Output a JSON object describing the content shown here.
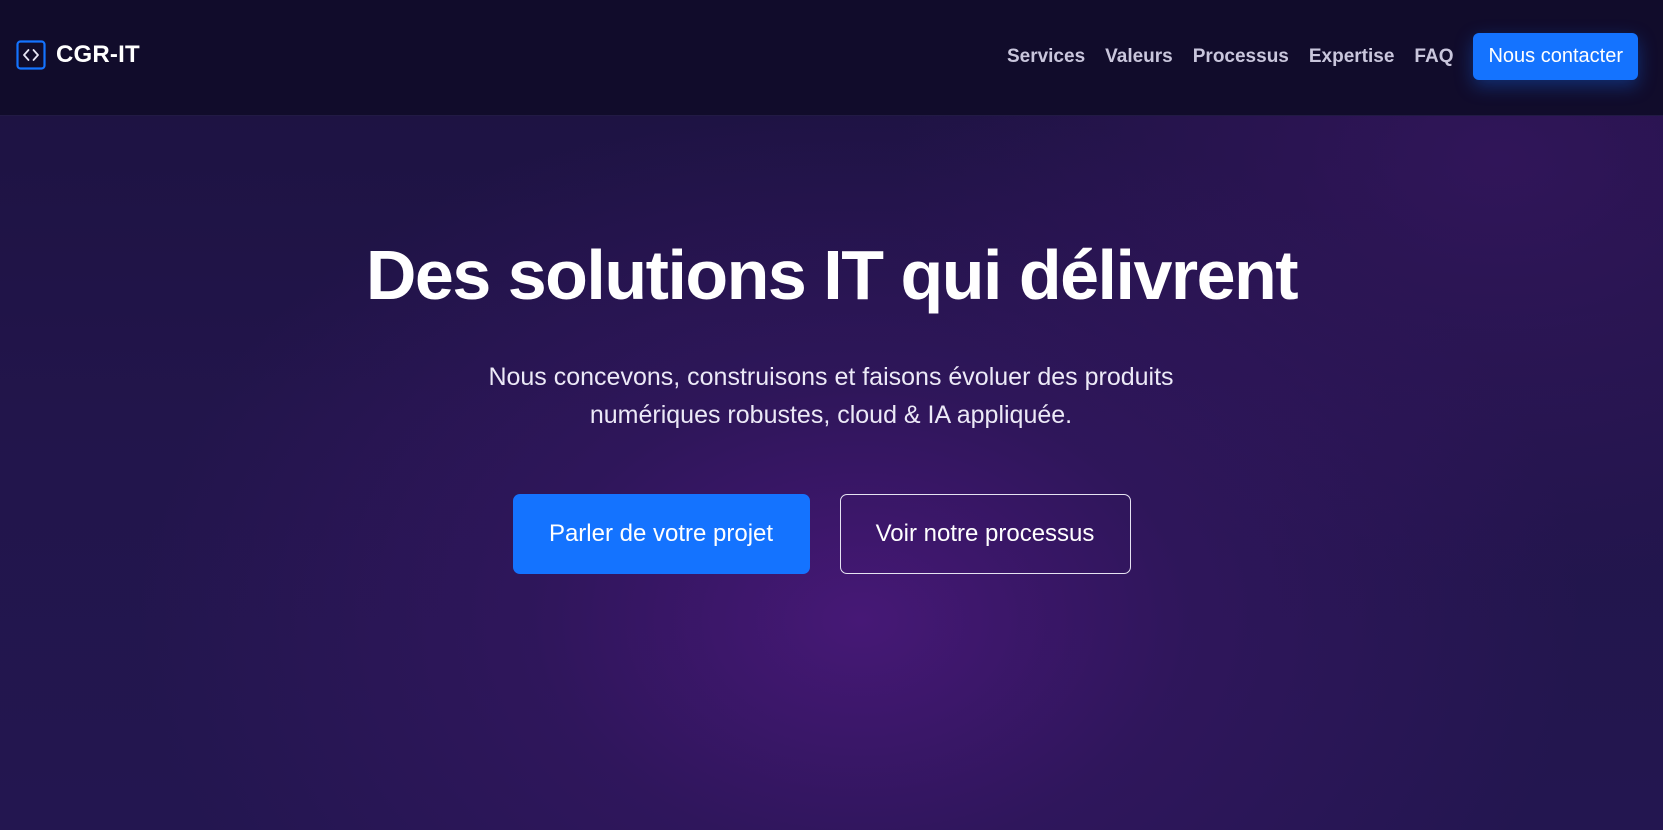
{
  "brand": {
    "name": "CGR-IT",
    "icon": "code-brackets-icon",
    "accent_color": "#1473ff"
  },
  "nav": {
    "links": [
      "Services",
      "Valeurs",
      "Processus",
      "Expertise",
      "FAQ"
    ],
    "cta_label": "Nous contacter"
  },
  "hero": {
    "title": "Des solutions IT qui délivrent",
    "subtitle": "Nous concevons, construisons et faisons évoluer des produits numériques robustes, cloud & IA appliquée.",
    "primary_button": "Parler de votre projet",
    "secondary_button": "Voir notre processus"
  },
  "colors": {
    "background": "#1c1240",
    "navbar": "#110c2b",
    "primary": "#1473ff"
  }
}
